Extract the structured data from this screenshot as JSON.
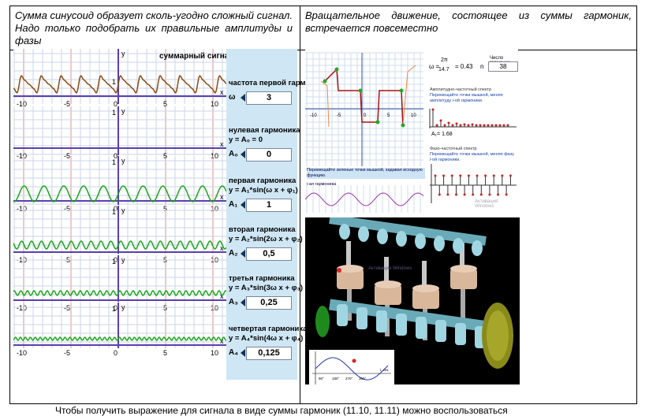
{
  "captions": {
    "left": "Сумма синусоид образует сколь-угодно сложный сигнал. Надо только подобрать их правильные амплитуды и фазы",
    "right": "Вращательное движение, состоящее из суммы гармоник, встречается повсеместно"
  },
  "bottom_text": "Чтобы получить выражение для сигнала в виде суммы гармоник (11.10, 11.11) можно воспользоваться",
  "left_panel": {
    "title": "суммарный сигнал",
    "axis_y": "y",
    "axis_x": "x",
    "ticks": [
      "-10",
      "-5",
      "0",
      "5",
      "10"
    ],
    "one": "1",
    "rows": [
      {
        "label1": "частота первой гармоники",
        "label2": "",
        "name": "ω",
        "value": "3"
      },
      {
        "label1": "нулевая гармоника",
        "label2": "y = A₀ = 0",
        "name": "A₀",
        "value": "0"
      },
      {
        "label1": "первая гармоника",
        "label2": "y = A₁*sin(ω x + φ₁)",
        "name": "A₁",
        "value": "1"
      },
      {
        "label1": "вторая гармоника",
        "label2": "y = A₂*sin(2ω x + φ₂)",
        "name": "A₂",
        "value": "0,5"
      },
      {
        "label1": "третья гармоника",
        "label2": "y = A₃*sin(3ω x + φ₃)",
        "name": "A₃",
        "value": "0,25"
      },
      {
        "label1": "четвертая гармоника",
        "label2": "y = A₄*sin(4ω x + φ₄)",
        "name": "A₄",
        "value": "0,125"
      }
    ]
  },
  "right_top": {
    "omega_label": "ω =",
    "omega_frac_num": "2π",
    "omega_frac_den": "14.7",
    "omega_val": "= 0.43",
    "n_label": "n",
    "n_value": "38",
    "harm_label": "Число гармоник",
    "amp_title": "Амплитудно-частотный спектр",
    "amp_hint": "Перемещайте точки мышкой, меняя амплитуду i-ой гармоники.",
    "a1_label": "A₁= 1.68",
    "phase_title": "Фазо-частотный спектр",
    "phase_hint": "Перемещайте точки мышкой, меняя фазу i-ой гармоники.",
    "drag_hint": "Перемещайте зеленые точки мышкой, задавая исходную функцию.",
    "harmonic_label": "i-ая гармоника",
    "watermark": "Активация Windows"
  },
  "right_bottom": {
    "graph_labels": [
      "90°",
      "180°",
      "270°",
      "360°"
    ],
    "t_label": "t, сек",
    "watermark": "Активация Windows"
  }
}
